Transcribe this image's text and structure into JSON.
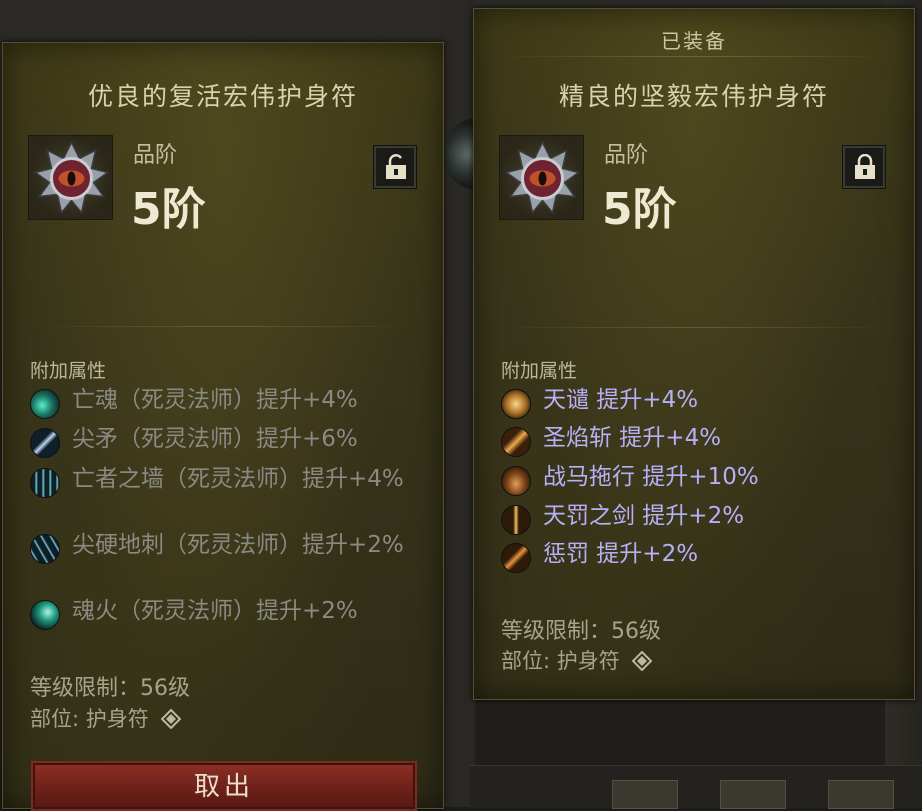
{
  "left_panel": {
    "item_name": "优良的复活宏伟护身符",
    "grade_label": "品阶",
    "grade_value": "5阶",
    "lock_state": "unlocked",
    "affix_header": "附加属性",
    "affixes": [
      {
        "text": "亡魂（死灵法师）提升+4%",
        "icon": "soul-wisp-icon"
      },
      {
        "text": "尖矛（死灵法师）提升+6%",
        "icon": "bone-spear-icon"
      },
      {
        "text": "亡者之墙（死灵法师）提升+4%",
        "icon": "bone-wall-icon"
      },
      {
        "text": "尖硬地刺（死灵法师）提升+2%",
        "icon": "bone-spikes-icon"
      },
      {
        "text": "魂火（死灵法师）提升+2%",
        "icon": "soul-fire-icon"
      }
    ],
    "level_requirement": "等级限制：56级",
    "slot": "部位: 护身符",
    "take_out_button": "取出"
  },
  "right_panel": {
    "equipped_label": "已装备",
    "item_name": "精良的坚毅宏伟护身符",
    "grade_label": "品阶",
    "grade_value": "5阶",
    "lock_state": "locked",
    "affix_header": "附加属性",
    "affixes": [
      {
        "text": "天谴  提升+4%",
        "icon": "condemnation-icon"
      },
      {
        "text": "圣焰斩  提升+4%",
        "icon": "holy-flame-slash-icon"
      },
      {
        "text": "战马拖行  提升+10%",
        "icon": "warhorse-drag-icon"
      },
      {
        "text": "天罚之剑  提升+2%",
        "icon": "sword-of-judgment-icon"
      },
      {
        "text": "惩罚  提升+2%",
        "icon": "punishment-icon"
      }
    ],
    "level_requirement": "等级限制：56级",
    "slot": "部位: 护身符"
  },
  "colors": {
    "panel_bg": "#3a3618",
    "affix_active": "#b6b0f7",
    "affix_inactive": "#8a8a84",
    "button_red": "#7a2b22"
  }
}
